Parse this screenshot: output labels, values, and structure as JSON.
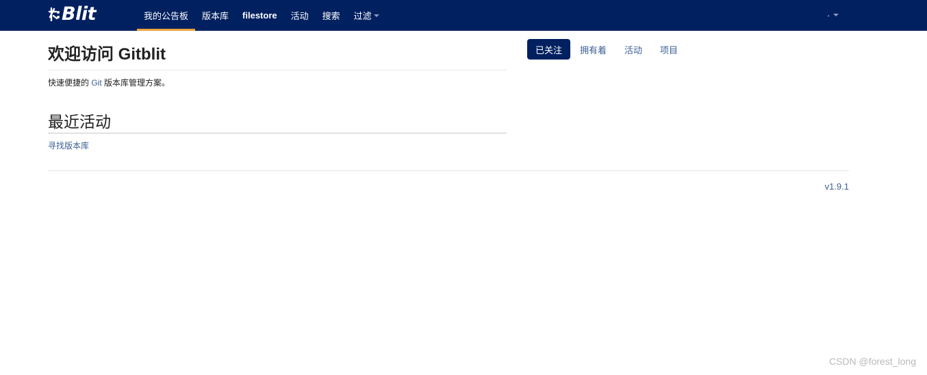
{
  "header": {
    "brand_prefix": "ﾎ",
    "brand_name": "Blit",
    "nav": [
      {
        "label": "我的公告板",
        "active": true
      },
      {
        "label": "版本库"
      },
      {
        "label": "filestore"
      },
      {
        "label": "活动"
      },
      {
        "label": "搜索"
      },
      {
        "label": "过滤",
        "dropdown": true
      }
    ],
    "user_label": "·"
  },
  "welcome": {
    "title": "欢迎访问 Gitblit",
    "desc_before": "快速便捷的 ",
    "desc_link": "Git",
    "desc_after": " 版本库管理方案。"
  },
  "activity": {
    "title": "最近活动",
    "find_link": "寻找版本库"
  },
  "tabs": [
    {
      "label": "已关注",
      "active": true
    },
    {
      "label": "拥有着"
    },
    {
      "label": "活动"
    },
    {
      "label": "项目"
    }
  ],
  "footer": {
    "version": "v1.9.1"
  },
  "watermark": "CSDN @forest_long",
  "colors": {
    "navbar": "#002060",
    "active_underline": "#e8a33d",
    "link": "#3b5f94"
  }
}
